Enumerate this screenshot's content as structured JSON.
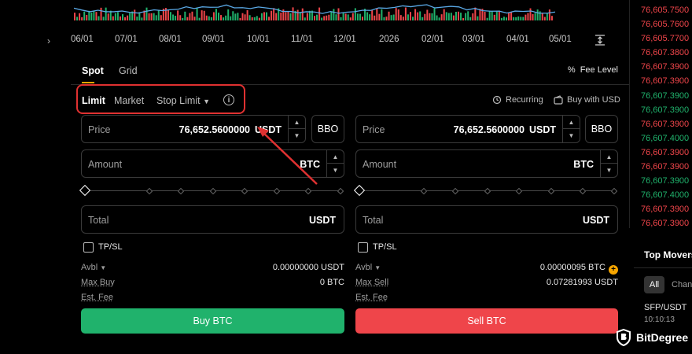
{
  "chart_axis": {
    "x_ticks": [
      "06/01",
      "07/01",
      "08/01",
      "09/01",
      "10/01",
      "11/01",
      "12/01",
      "2026",
      "02/01",
      "03/01",
      "04/01",
      "05/01"
    ]
  },
  "tabs": [
    {
      "label": "Spot",
      "active": true
    },
    {
      "label": "Grid",
      "active": false
    }
  ],
  "fee_level": "Fee Level",
  "order_types": {
    "limit": "Limit",
    "market": "Market",
    "stop_limit": "Stop Limit"
  },
  "recurring": "Recurring",
  "buy_with_usd": "Buy with USD",
  "buy": {
    "price_label": "Price",
    "price_value": "76,652.5600000",
    "price_unit": "USDT",
    "bbo": "BBO",
    "amount_label": "Amount",
    "amount_unit": "BTC",
    "total_label": "Total",
    "total_unit": "USDT",
    "tpsl": "TP/SL",
    "avbl_label": "Avbl",
    "avbl_value": "0.00000000 USDT",
    "max_label": "Max Buy",
    "max_value": "0 BTC",
    "fee_label": "Est. Fee",
    "button": "Buy BTC"
  },
  "sell": {
    "price_label": "Price",
    "price_value": "76,652.5600000",
    "price_unit": "USDT",
    "bbo": "BBO",
    "amount_label": "Amount",
    "amount_unit": "BTC",
    "total_label": "Total",
    "total_unit": "USDT",
    "tpsl": "TP/SL",
    "avbl_label": "Avbl",
    "avbl_value": "0.00000095 BTC",
    "max_label": "Max Sell",
    "max_value": "0.07281993 USDT",
    "fee_label": "Est. Fee",
    "button": "Sell BTC"
  },
  "orderbook": [
    {
      "price": "76,605.7500",
      "side": "sell"
    },
    {
      "price": "76,605.7600",
      "side": "sell"
    },
    {
      "price": "76,605.7700",
      "side": "sell"
    },
    {
      "price": "76,607.3800",
      "side": "sell"
    },
    {
      "price": "76,607.3900",
      "side": "sell"
    },
    {
      "price": "76,607.3900",
      "side": "sell"
    },
    {
      "price": "76,607.3900",
      "side": "buy"
    },
    {
      "price": "76,607.3900",
      "side": "buy"
    },
    {
      "price": "76,607.3900",
      "side": "sell"
    },
    {
      "price": "76,607.4000",
      "side": "buy"
    },
    {
      "price": "76,607.3900",
      "side": "sell"
    },
    {
      "price": "76,607.3900",
      "side": "sell"
    },
    {
      "price": "76,607.3900",
      "side": "buy"
    },
    {
      "price": "76,607.4000",
      "side": "buy"
    },
    {
      "price": "76,607.3900",
      "side": "sell"
    },
    {
      "price": "76,607.3900",
      "side": "sell"
    }
  ],
  "top_movers": {
    "title": "Top Movers",
    "filter_all": "All",
    "filter_change": "Chan",
    "pair": "SFP/USDT",
    "time": "10:10:13"
  },
  "watermark": "BitDegree",
  "colors": {
    "accent": "#f7a600",
    "buy": "#20b26c",
    "sell": "#ef454a",
    "highlight": "#e03131"
  }
}
